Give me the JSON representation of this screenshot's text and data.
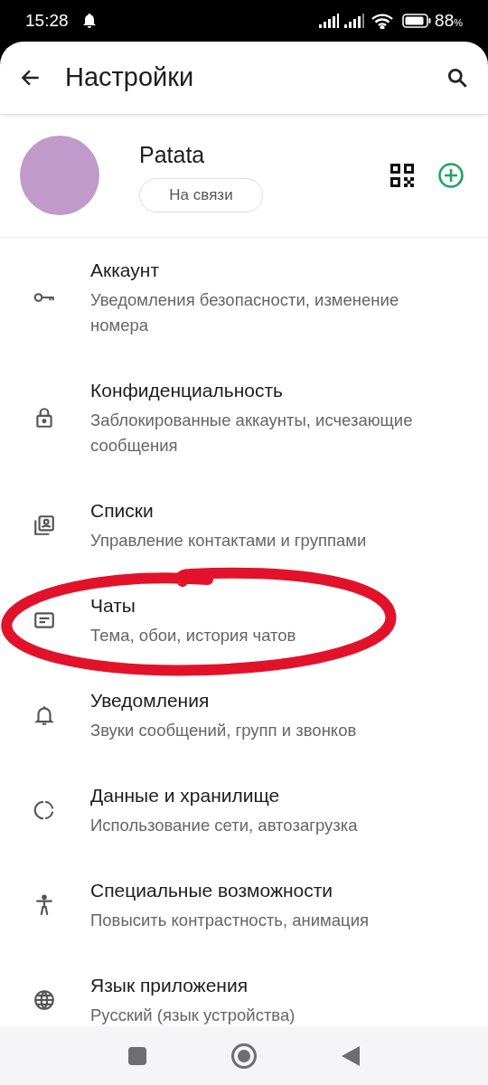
{
  "status_bar": {
    "time": "15:28",
    "battery": "88",
    "battery_unit": "%"
  },
  "app_bar": {
    "title": "Настройки"
  },
  "profile": {
    "name": "Patata",
    "status": "На связи"
  },
  "items": [
    {
      "title": "Аккаунт",
      "subtitle": "Уведомления безопасности, изменение номера"
    },
    {
      "title": "Конфиденциальность",
      "subtitle": "Заблокированные аккаунты, исчезающие сообщения"
    },
    {
      "title": "Списки",
      "subtitle": "Управление контактами и группами"
    },
    {
      "title": "Чаты",
      "subtitle": "Тема, обои, история чатов"
    },
    {
      "title": "Уведомления",
      "subtitle": "Звуки сообщений, групп и звонков"
    },
    {
      "title": "Данные и хранилище",
      "subtitle": "Использование сети, автозагрузка"
    },
    {
      "title": "Специальные возможности",
      "subtitle": "Повысить контрастность, анимация"
    },
    {
      "title": "Язык приложения",
      "subtitle": "Русский (язык устройства)"
    }
  ]
}
